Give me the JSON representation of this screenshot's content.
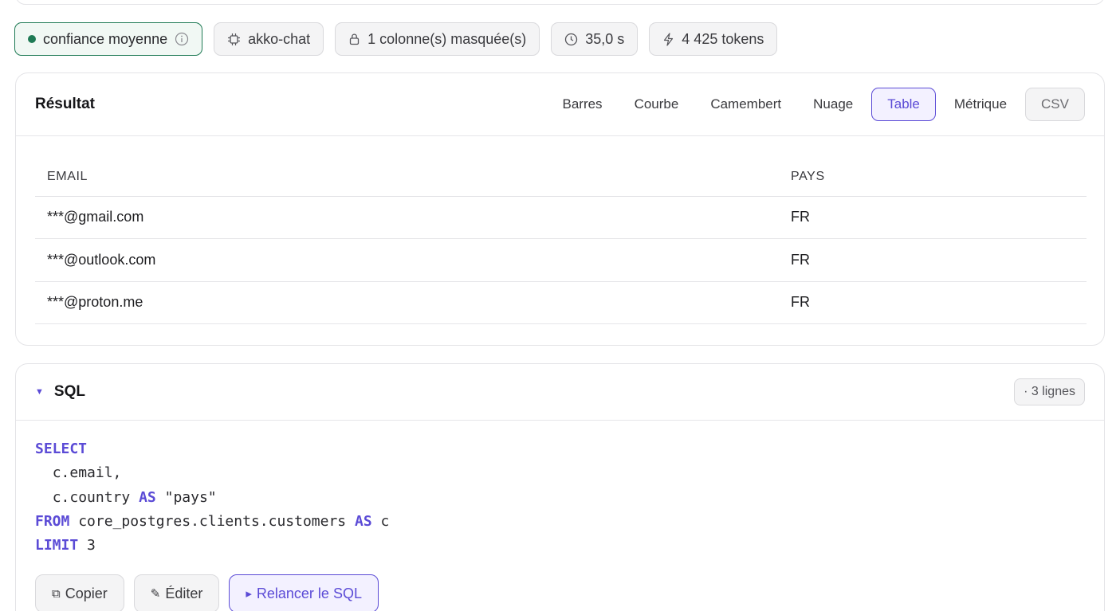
{
  "meta_chips": {
    "confidence": "confiance moyenne",
    "model": "akko-chat",
    "masked": "1 colonne(s) masquée(s)",
    "duration": "35,0 s",
    "tokens": "4 425 tokens"
  },
  "colors": {
    "accent": "#5b4bd6",
    "confidence_green": "#1f7a55"
  },
  "result": {
    "title": "Résultat",
    "tabs": [
      "Barres",
      "Courbe",
      "Camembert",
      "Nuage",
      "Table",
      "Métrique"
    ],
    "active_tab": "Table",
    "csv_label": "CSV",
    "columns": [
      "EMAIL",
      "PAYS"
    ],
    "rows": [
      [
        "***@gmail.com",
        "FR"
      ],
      [
        "***@outlook.com",
        "FR"
      ],
      [
        "***@proton.me",
        "FR"
      ]
    ]
  },
  "sql": {
    "title": "SQL",
    "row_count": "· 3 lignes",
    "code": {
      "select_kw": "SELECT",
      "line_email": "c.email,",
      "line_country": "c.country",
      "as_kw": "AS",
      "alias": "\"pays\"",
      "from_kw": "FROM",
      "table": "core_postgres.clients.customers",
      "table_alias": "c",
      "limit_kw": "LIMIT",
      "limit_value": "3"
    },
    "buttons": {
      "copy": "Copier",
      "edit": "Éditer",
      "rerun": "Relancer le SQL"
    }
  }
}
